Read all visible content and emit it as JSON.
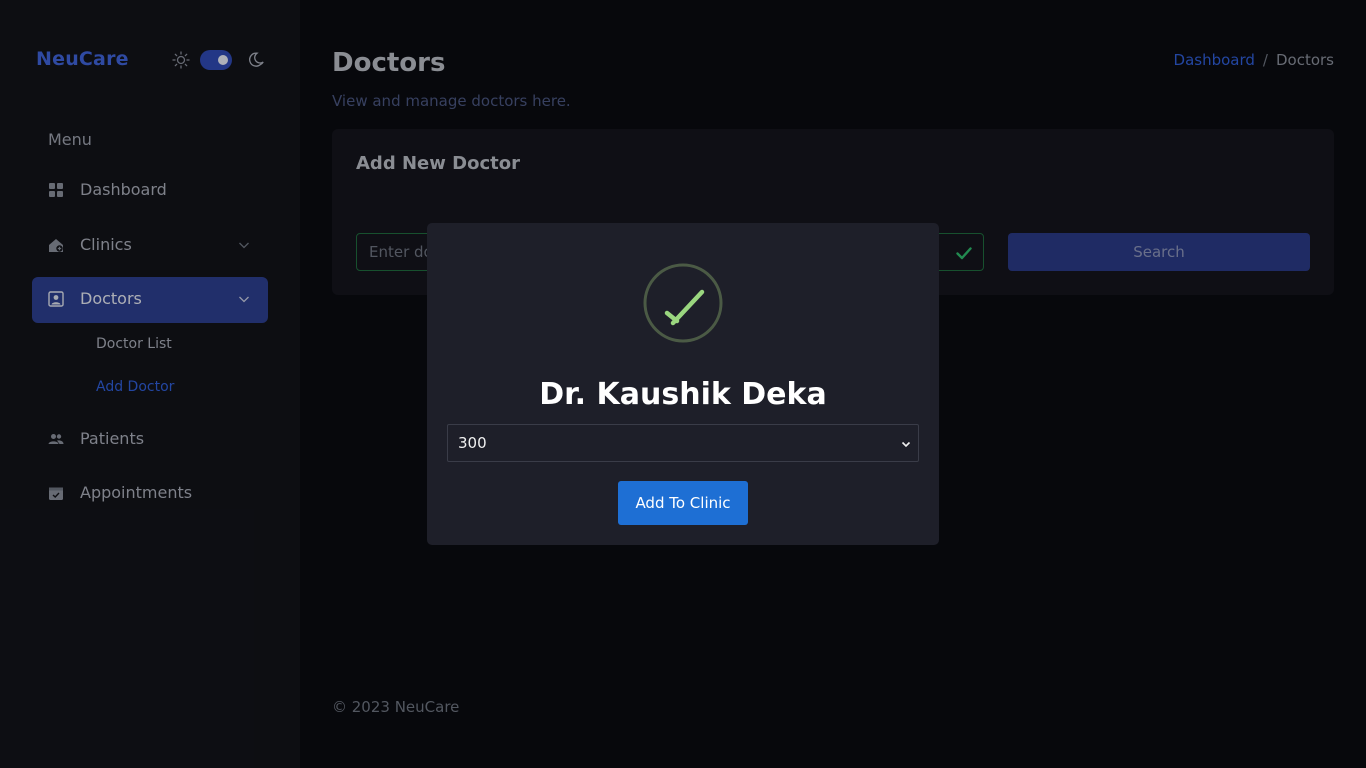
{
  "sidebar": {
    "brand": "NeuCare",
    "theme": {
      "mode": "dark",
      "sun_icon": "sun-icon",
      "moon_icon": "moon-icon"
    },
    "menu_title": "Menu",
    "items": [
      {
        "label": "Dashboard",
        "icon": "grid-icon"
      },
      {
        "label": "Clinics",
        "icon": "clinic-icon"
      },
      {
        "label": "Doctors",
        "icon": "doctor-icon",
        "active": true
      },
      {
        "label": "Patients",
        "icon": "users-icon"
      },
      {
        "label": "Appointments",
        "icon": "calendar-check-icon"
      }
    ],
    "doctor_subitems": [
      {
        "label": "Doctor List"
      },
      {
        "label": "Add Doctor",
        "active": true
      }
    ]
  },
  "header": {
    "title": "Doctors",
    "subtitle": "View and manage doctors here.",
    "breadcrumb": {
      "parent": "Dashboard",
      "separator": "/",
      "current": "Doctors"
    }
  },
  "card": {
    "title": "Add New Doctor",
    "input_placeholder": "Enter doctor email",
    "search_label": "Search"
  },
  "modal": {
    "doctor_name": "Dr. Kaushik Deka",
    "clinic_select_value": "300",
    "add_button_label": "Add To Clinic",
    "success_icon": "check-circle-icon"
  },
  "footer": {
    "text": "© 2023 NeuCare"
  },
  "colors": {
    "accent": "#2f5ed8",
    "active_nav": "#2d3f8f",
    "primary_button": "#1e6fd4",
    "success": "#9ad67f"
  }
}
